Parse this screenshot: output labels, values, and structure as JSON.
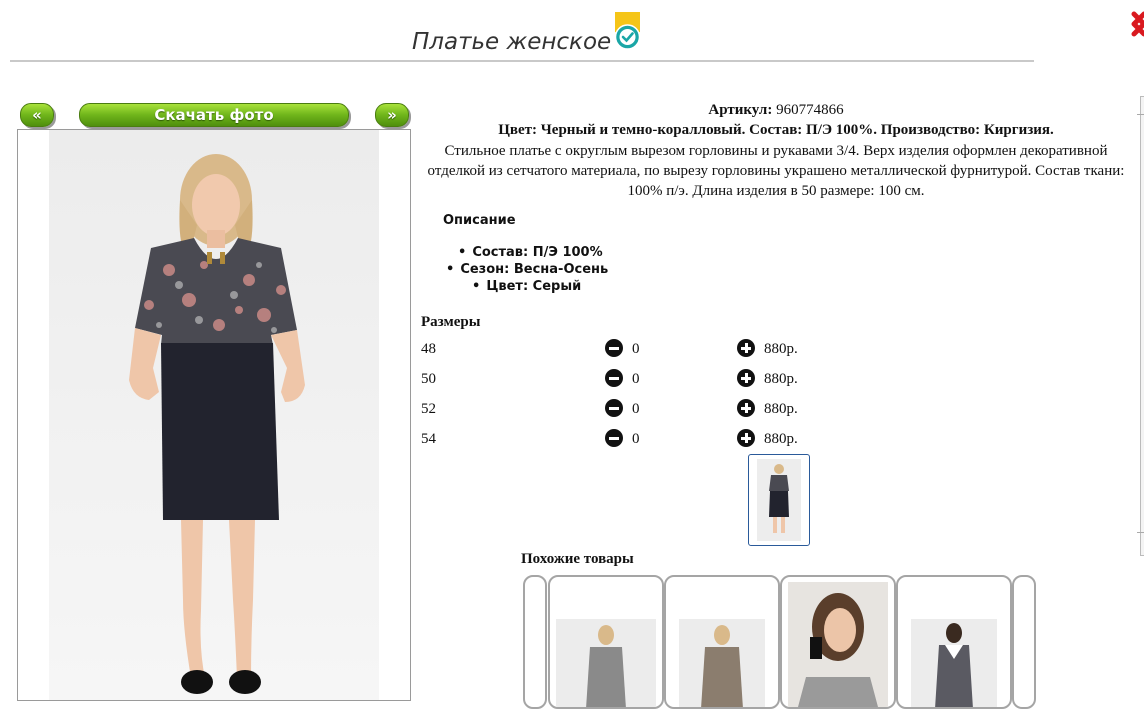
{
  "page": {
    "title": "Платье женское"
  },
  "nav": {
    "prev": "«",
    "download": "Скачать фото",
    "next": "»"
  },
  "product": {
    "article_label": "Артикул:",
    "article_value": "960774866",
    "color_line": "Цвет: Черный и темно-коралловый. Состав: П/Э 100%. Производство: Киргизия.",
    "description": "Стильное платье с округлым вырезом горловины и рукавами 3/4. Верх изделия оформлен декоративной отделкой из сетчатого материала, по вырезу горловины украшено металлической фурнитурой. Состав ткани: 100% п/э. Длина изделия в 50 размере: 100 см.",
    "details_heading": "Описание",
    "details": [
      "Состав: П/Э 100%",
      "Сезон: Весна-Осень",
      "Цвет: Серый"
    ]
  },
  "sizes": {
    "heading": "Размеры",
    "rows": [
      {
        "size": "48",
        "qty": "0",
        "price": "880р."
      },
      {
        "size": "50",
        "qty": "0",
        "price": "880р."
      },
      {
        "size": "52",
        "qty": "0",
        "price": "880р."
      },
      {
        "size": "54",
        "qty": "0",
        "price": "880р."
      }
    ]
  },
  "similar": {
    "heading": "Похожие товары"
  },
  "colors": {
    "accent_green": "#6fb51b",
    "badge_yellow": "#f5c518",
    "badge_teal": "#1aa6a6",
    "close_red": "#d9191f"
  },
  "icons": {
    "verified": "verified-badge-icon",
    "minus": "minus-circle-icon",
    "plus": "plus-circle-icon",
    "close": "close-icon"
  }
}
